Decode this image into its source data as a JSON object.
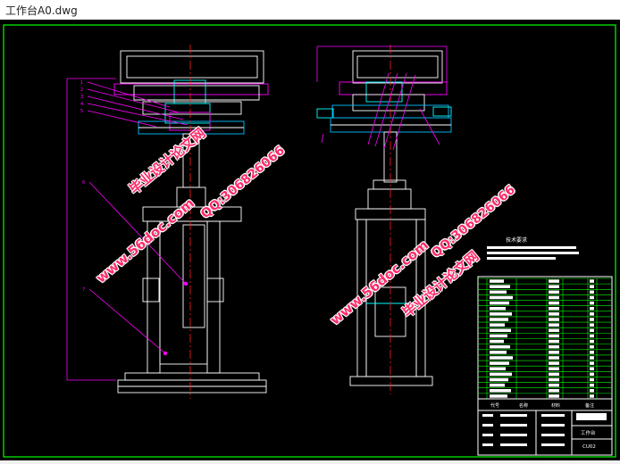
{
  "window": {
    "title": "工作台A0.dwg"
  },
  "drawing": {
    "tech_req_title": "技术要求",
    "title_block": {
      "part_name": "工作台",
      "drawing_no": "CU02",
      "bom_header": [
        "代号",
        "名称",
        "材料",
        "备注"
      ]
    }
  },
  "watermarks": [
    {
      "text": "毕业设计论文网"
    },
    {
      "text": "www.56doc.com"
    },
    {
      "text": "QQ:306826066"
    },
    {
      "text": "QQ:306826066"
    },
    {
      "text": "www.56doc.com"
    },
    {
      "text": "毕业设计论文网"
    }
  ],
  "colors": {
    "background": "#000000",
    "frame": "#00ff00",
    "outline": "#ffffff",
    "leader": "#ff00ff",
    "centerline": "#ff2020",
    "accent": "#00bfff",
    "watermark": "#ff2b6a"
  }
}
